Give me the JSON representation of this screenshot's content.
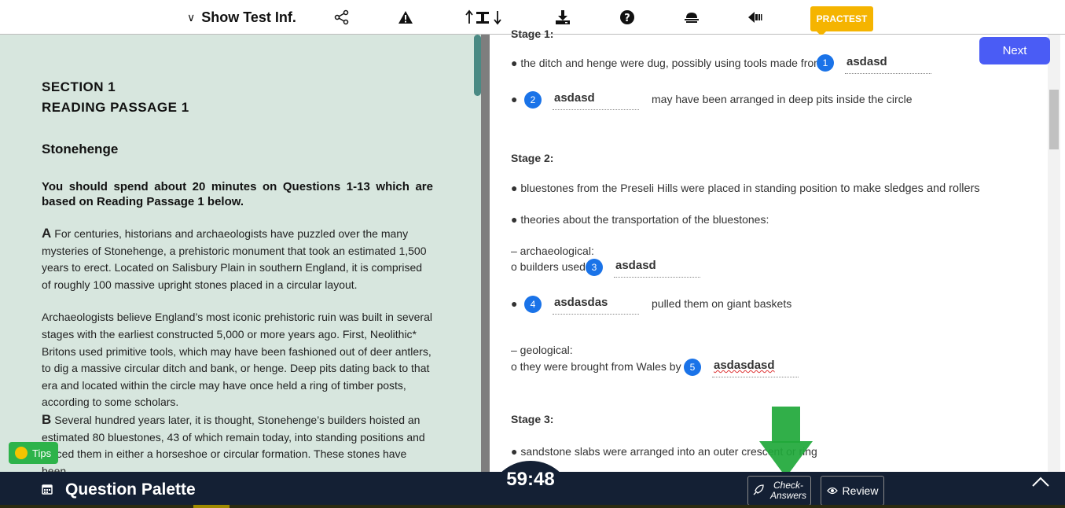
{
  "toolbar": {
    "show_test_info": "Show Test Inf.",
    "brand": "PRACTEST",
    "icons": [
      "share-icon",
      "warning-icon",
      "text-size-icon",
      "download-icon",
      "help-icon",
      "highlight-icon",
      "back-icon"
    ]
  },
  "passage": {
    "section": "SECTION 1",
    "passage_label": "READING PASSAGE 1",
    "title": "Stonehenge",
    "instruction": "You should spend about 20 minutes on Questions 1-13 which are based on Reading Passage 1 below.",
    "para_a_letter": "A",
    "para_a": "For centuries, historians and archaeologists have puzzled over the many mysteries of Stonehenge, a prehistoric monument that took an estimated 1,500 years to erect. Located on Salisbury Plain in southern England, it is comprised of roughly 100 massive upright stones placed in a circular layout.",
    "para_a2": "Archaeologists believe England’s most iconic prehistoric ruin was built in several stages with the earliest constructed 5,000 or more years ago. First, Neolithic* Britons used primitive tools, which may have been fashioned out of deer antlers, to dig a massive circular ditch and bank, or henge. Deep pits dating back to that era and located within the circle may have once held a ring of timber posts, according to some scholars.",
    "para_b_letter": "B",
    "para_b": "Several hundred years later, it is thought, Stonehenge’s builders hoisted an estimated 80 bluestones, 43 of which remain today, into standing positions and placed them in either a horseshoe or circular formation. These stones have been"
  },
  "questions": {
    "stage1_label": "Stage 1:",
    "q1_prefix": "● the ditch and henge were dug, possibly using tools made from",
    "q1_num": "1",
    "q1_answer": "asdasd",
    "bullet": "●",
    "q2_num": "2",
    "q2_answer": "asdasd",
    "q2_suffix": "may have been arranged in deep pits inside the circle",
    "stage2_label": "Stage 2:",
    "stage2_line1": "● bluestones from the Preseli Hills were placed in standing position",
    "stage2_line1b": "to make sledges and rollers",
    "stage2_line2": "● theories about the transportation of the bluestones:",
    "arch_label": "– archaeological:",
    "q3_prefix": "o builders used",
    "q3_num": "3",
    "q3_answer": "asdasd",
    "q4_num": "4",
    "q4_answer": "asdasdas",
    "q4_suffix": "pulled them on giant baskets",
    "geo_label": "– geological:",
    "q5_prefix": "o they were brought from Wales by",
    "q5_num": "5",
    "q5_answer": "asdasdasd",
    "stage3_label": "Stage 3:",
    "stage3_line1": "● sandstone slabs were arranged into an outer crescent or ring"
  },
  "nav": {
    "next_label": "Next"
  },
  "footer": {
    "palette_label": "Question Palette",
    "timer": "59:48",
    "check_answers_label": "Check-\nAnswers",
    "check_line1": "Check-",
    "check_line2": "Answers",
    "review_label": "Review",
    "tips_label": "Tips"
  },
  "colors": {
    "accent": "#4a5cf5",
    "number_badge": "#1a73e8",
    "footer_bg": "#142034",
    "passage_bg": "#d7e6de",
    "tips_green": "#2db34a",
    "brand_yellow": "#f5b400"
  }
}
